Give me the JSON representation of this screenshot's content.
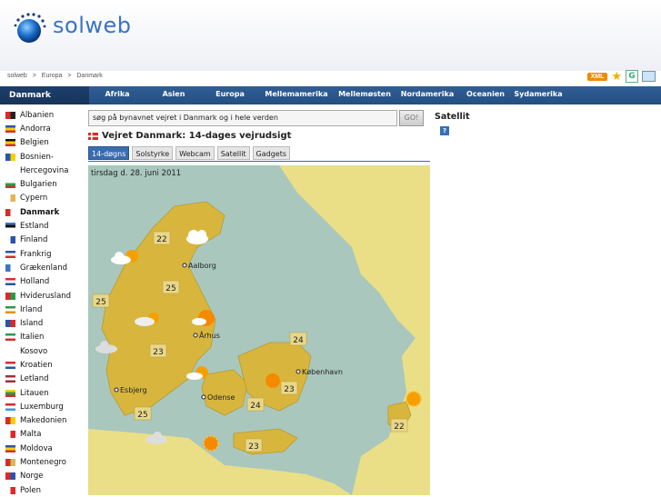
{
  "logo": {
    "text": "solweb"
  },
  "breadcrumb": [
    "solweb",
    ">",
    "Europa",
    ">",
    "Danmark"
  ],
  "toolbar": {
    "xml": "XML",
    "g": "G"
  },
  "nav": {
    "current": "Danmark",
    "items": [
      "Afrika",
      "Asien",
      "Europa",
      "Mellemamerika",
      "Mellemøsten",
      "Nordamerika",
      "Oceanien",
      "Sydamerika"
    ]
  },
  "sidebar": {
    "countries": [
      {
        "label": "Albanien",
        "flag": [
          "#d82b2b",
          "#222222"
        ]
      },
      {
        "label": "Andorra",
        "flag": [
          "#2a54a8",
          "#f5d000",
          "#d82b2b"
        ]
      },
      {
        "label": "Belgien",
        "flag": [
          "#111111",
          "#f5d000",
          "#d82b2b"
        ]
      },
      {
        "label": "Bosnien-",
        "flag": [
          "#2a54a8",
          "#f5d000"
        ]
      },
      {
        "label": "Hercegovina",
        "flag": null
      },
      {
        "label": "Bulgarien",
        "flag": [
          "#ffffff",
          "#2a9a4a",
          "#d82b2b"
        ]
      },
      {
        "label": "Cypern",
        "flag": [
          "#ffffff",
          "#e3b45a"
        ]
      },
      {
        "label": "Danmark",
        "flag": [
          "#d82b2b",
          "#ffffff"
        ],
        "active": true
      },
      {
        "label": "Estland",
        "flag": [
          "#3a75c4",
          "#111111",
          "#ffffff"
        ]
      },
      {
        "label": "Finland",
        "flag": [
          "#ffffff",
          "#2a54a8"
        ]
      },
      {
        "label": "Frankrig",
        "flag": [
          "#2a54a8",
          "#ffffff",
          "#d82b2b"
        ]
      },
      {
        "label": "Grækenland",
        "flag": [
          "#3a75c4",
          "#ffffff"
        ]
      },
      {
        "label": "Holland",
        "flag": [
          "#d82b2b",
          "#ffffff",
          "#2a54a8"
        ]
      },
      {
        "label": "Hviderusland",
        "flag": [
          "#d82b2b",
          "#2a9a4a"
        ]
      },
      {
        "label": "Irland",
        "flag": [
          "#2a9a4a",
          "#ffffff",
          "#f08a00"
        ]
      },
      {
        "label": "Island",
        "flag": [
          "#2a54a8",
          "#d82b2b"
        ]
      },
      {
        "label": "Italien",
        "flag": [
          "#2a9a4a",
          "#ffffff",
          "#d82b2b"
        ]
      },
      {
        "label": "Kosovo",
        "flag": null
      },
      {
        "label": "Kroatien",
        "flag": [
          "#d82b2b",
          "#ffffff",
          "#2a54a8"
        ]
      },
      {
        "label": "Letland",
        "flag": [
          "#9e3039",
          "#ffffff",
          "#9e3039"
        ]
      },
      {
        "label": "Litauen",
        "flag": [
          "#f5d000",
          "#2a9a4a",
          "#d82b2b"
        ]
      },
      {
        "label": "Luxemburg",
        "flag": [
          "#d82b2b",
          "#ffffff",
          "#3a9ad8"
        ]
      },
      {
        "label": "Makedonien",
        "flag": [
          "#d82b2b",
          "#f5d000"
        ]
      },
      {
        "label": "Malta",
        "flag": [
          "#ffffff",
          "#d82b2b"
        ]
      },
      {
        "label": "Moldova",
        "flag": [
          "#2a54a8",
          "#f5d000",
          "#d82b2b"
        ]
      },
      {
        "label": "Montenegro",
        "flag": [
          "#d82b2b",
          "#e3b45a"
        ]
      },
      {
        "label": "Norge",
        "flag": [
          "#d82b2b",
          "#2a54a8"
        ]
      },
      {
        "label": "Polen",
        "flag": [
          "#ffffff",
          "#d82b2b"
        ]
      }
    ]
  },
  "search": {
    "text": "søg på bynavnet vejret i Danmark og i hele verden",
    "button": "GO!"
  },
  "satellite": {
    "title": "Satellit",
    "help": "?"
  },
  "page": {
    "title": "Vejret Danmark: 14-dages vejrudsigt"
  },
  "tabs": [
    "14-døgns",
    "Solstyrke",
    "Webcam",
    "Satellit",
    "Gadgets"
  ],
  "map": {
    "date": "tirsdag d. 28. juni 2011",
    "temps": [
      "22",
      "25",
      "25",
      "23",
      "24",
      "24",
      "23",
      "25",
      "23",
      "22"
    ],
    "cities": [
      "Aalborg",
      "Århus",
      "København",
      "Esbjerg",
      "Odense"
    ],
    "colors": {
      "sea": "#a9c7bc",
      "land": "#d8b63e",
      "sweden": "#eadf86"
    }
  }
}
